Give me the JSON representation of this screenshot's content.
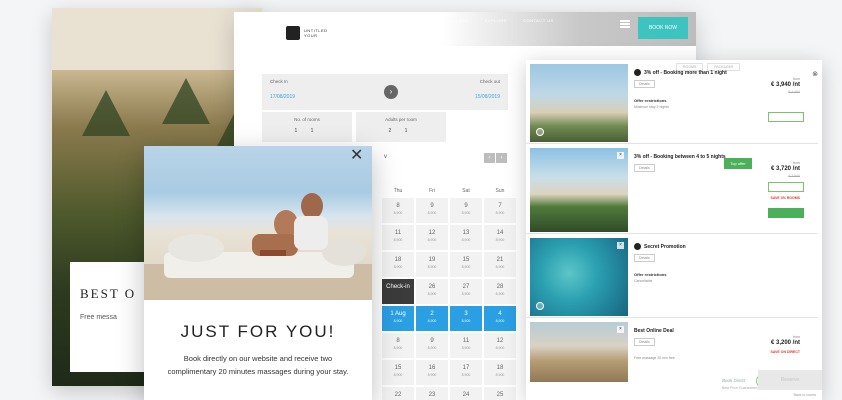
{
  "site": {
    "card_title": "BEST O",
    "card_sub": "Free messa"
  },
  "booking": {
    "logo_text": "UNTITLED YOUR",
    "nav": [
      "",
      "TELLWE",
      "EXPLORE",
      "CONTACT US"
    ],
    "book_now": "BOOK NOW",
    "checkin": {
      "label": "Check In",
      "value": "17/08/2019"
    },
    "checkout": {
      "label": "Check out",
      "value": "15/08/2019"
    },
    "guests": [
      {
        "label": "No. of rooms",
        "value": "1  1"
      },
      {
        "label": "Adults per room",
        "value": "2  1"
      }
    ],
    "month": "v",
    "month_prev": "‹",
    "month_next": "›",
    "days_of_week": [
      "Thu",
      "Fri",
      "Sat",
      "Sun"
    ],
    "weeks": [
      [
        {
          "d": "8",
          "p": "8,900"
        },
        {
          "d": "9",
          "p": "8,900"
        },
        {
          "d": "9",
          "p": "8,900"
        },
        {
          "d": "7",
          "p": "8,900"
        }
      ],
      [
        {
          "d": "11",
          "p": "8,900"
        },
        {
          "d": "12",
          "p": "8,900"
        },
        {
          "d": "13",
          "p": "8,900"
        },
        {
          "d": "14",
          "p": "8,900"
        }
      ],
      [
        {
          "d": "18",
          "p": "8,900"
        },
        {
          "d": "19",
          "p": "8,900"
        },
        {
          "d": "15",
          "p": "8,900"
        },
        {
          "d": "21",
          "p": "8,900"
        }
      ],
      [
        {
          "d": "Check-in",
          "p": "",
          "dark": true
        },
        {
          "d": "26",
          "p": "8,900"
        },
        {
          "d": "27",
          "p": "8,900"
        },
        {
          "d": "28",
          "p": "8,900"
        }
      ],
      [
        {
          "d": "1 Aug",
          "p": "8,900",
          "sel": true
        },
        {
          "d": "2",
          "p": "8,900",
          "sel": true
        },
        {
          "d": "3",
          "p": "8,900",
          "sel": true
        },
        {
          "d": "4",
          "p": "8,900",
          "sel": true
        }
      ],
      [
        {
          "d": "8",
          "p": "8,900"
        },
        {
          "d": "9",
          "p": "8,900"
        },
        {
          "d": "11",
          "p": "8,900"
        },
        {
          "d": "12",
          "p": "8,900"
        }
      ],
      [
        {
          "d": "15",
          "p": "8,900"
        },
        {
          "d": "16",
          "p": "8,900"
        },
        {
          "d": "17",
          "p": "8,900"
        },
        {
          "d": "18",
          "p": "8,900"
        }
      ],
      [
        {
          "d": "22",
          "p": ""
        },
        {
          "d": "23",
          "p": ""
        },
        {
          "d": "24",
          "p": ""
        },
        {
          "d": "25",
          "p": ""
        }
      ]
    ]
  },
  "offers": {
    "tabs": [
      "ROOMS",
      "PACKAGES"
    ],
    "close": "⊗",
    "items": [
      {
        "title": "3% off - Booking more than 1 night",
        "tag": "Details",
        "sub": "Offer restrictions",
        "sub2": "Minimum stay 2 nights",
        "price_label": "from",
        "price": "€ 3,940 /nt",
        "strike": "€ 4,060",
        "red": ""
      },
      {
        "title": "3% off - Booking between 4 to 5 nights",
        "tag": "Details",
        "sub": "",
        "sub2": "",
        "price_label": "from",
        "price": "€ 3,720 /nt",
        "strike": "€ 3,840",
        "red": "SAVE 3% ROOMS",
        "badge": "Top offer"
      },
      {
        "title": "Secret Promotion",
        "tag": "Details",
        "sub": "Offer restrictions",
        "sub2": "Cancellable",
        "price_label": "",
        "price": "",
        "strike": "",
        "red": ""
      },
      {
        "title": "Best Online Deal",
        "tag": "Details",
        "sub": "",
        "sub2": "Free massage 20 min free",
        "price_label": "from",
        "price": "€ 3,200 /nt",
        "strike": "",
        "red": "SAVE ON DIRECT"
      }
    ],
    "footer_label": "Book Direct",
    "footer_sub": "Best Price Guaranteed",
    "footer_button": "Reserve",
    "footer_link": "Back to rooms"
  },
  "popup": {
    "close": "✕",
    "title": "JUST FOR YOU!",
    "text": "Book directly on our website and receive two complimentary 20 minutes massages during your stay."
  },
  "colors": {
    "accent": "#3ec4c0",
    "selected_day": "#2a9fe3",
    "offer_green": "#4cb05a",
    "save_red": "#e1352f"
  }
}
